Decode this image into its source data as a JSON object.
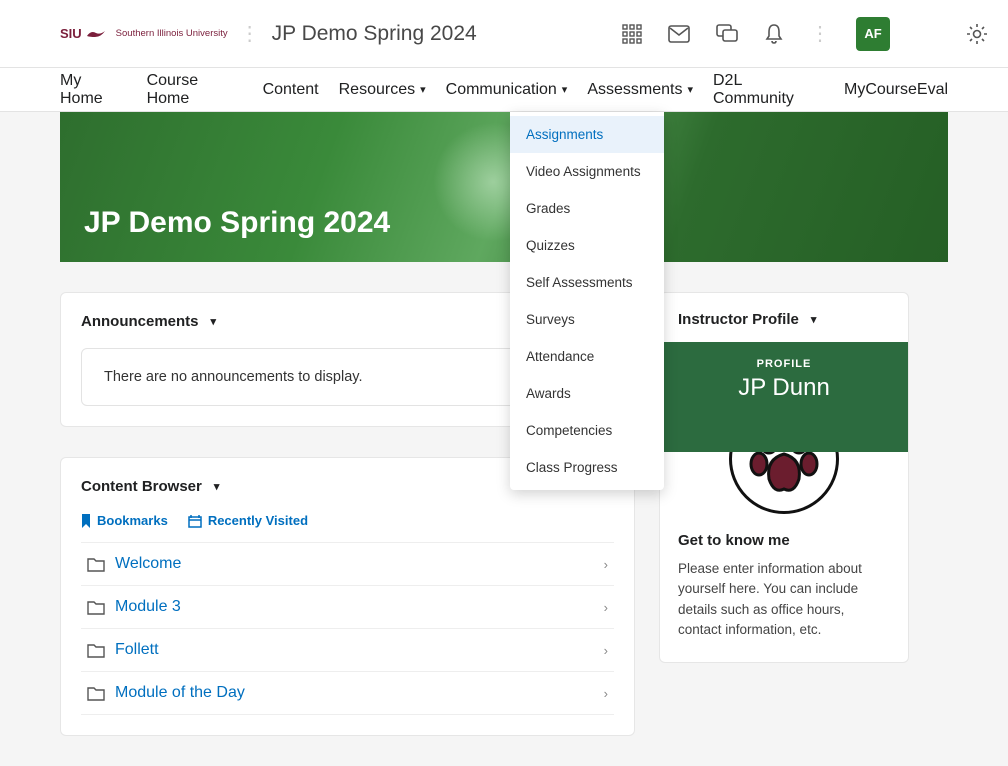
{
  "header": {
    "org_short": "SIU",
    "org_full": "Southern Illinois University",
    "course_title": "JP Demo Spring 2024",
    "user_initials": "AF"
  },
  "nav": {
    "items": [
      {
        "label": "My Home",
        "hasMenu": false
      },
      {
        "label": "Course Home",
        "hasMenu": false
      },
      {
        "label": "Content",
        "hasMenu": false
      },
      {
        "label": "Resources",
        "hasMenu": true
      },
      {
        "label": "Communication",
        "hasMenu": true
      },
      {
        "label": "Assessments",
        "hasMenu": true
      },
      {
        "label": "D2L Community",
        "hasMenu": false
      },
      {
        "label": "MyCourseEval",
        "hasMenu": false
      }
    ]
  },
  "assessments_menu": {
    "items": [
      "Assignments",
      "Video Assignments",
      "Grades",
      "Quizzes",
      "Self Assessments",
      "Surveys",
      "Attendance",
      "Awards",
      "Competencies",
      "Class Progress"
    ],
    "active_index": 0
  },
  "banner": {
    "title": "JP Demo Spring 2024"
  },
  "announcements": {
    "heading": "Announcements",
    "empty_text": "There are no announcements to display."
  },
  "content_browser": {
    "heading": "Content Browser",
    "tabs": {
      "bookmarks": "Bookmarks",
      "recent": "Recently Visited"
    },
    "items": [
      {
        "label": "Welcome"
      },
      {
        "label": "Module 3"
      },
      {
        "label": "Follett"
      },
      {
        "label": "Module of the Day"
      }
    ]
  },
  "instructor": {
    "heading": "Instructor Profile",
    "profile_label": "PROFILE",
    "name": "JP Dunn",
    "section_title": "Get to know me",
    "description": "Please enter information about yourself here. You can include details such as office hours, contact information, etc."
  }
}
